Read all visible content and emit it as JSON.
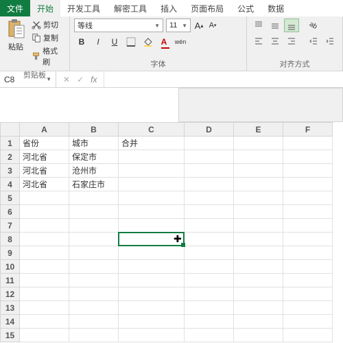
{
  "tabs": {
    "file": "文件",
    "home": "开始",
    "dev": "开发工具",
    "decrypt": "解密工具",
    "insert": "插入",
    "layout": "页面布局",
    "formulas": "公式",
    "data": "数据"
  },
  "clipboard": {
    "cut": "剪切",
    "copy": "复制",
    "paint": "格式刷",
    "paste": "粘贴",
    "group": "剪贴板"
  },
  "font": {
    "name": "等线",
    "size": "11",
    "group": "字体",
    "bold": "B",
    "italic": "I",
    "underline": "U",
    "wen": "wén"
  },
  "align": {
    "group": "对齐方式"
  },
  "namebox": "C8",
  "cols": [
    "A",
    "B",
    "C",
    "D",
    "E",
    "F"
  ],
  "rows": [
    "1",
    "2",
    "3",
    "4",
    "5",
    "6",
    "7",
    "8",
    "9",
    "10",
    "11",
    "12",
    "13",
    "14",
    "15"
  ],
  "cells": {
    "A1": "省份",
    "B1": "城市",
    "C1": "合并",
    "A2": "河北省",
    "B2": "保定市",
    "A3": "河北省",
    "B3": "沧州市",
    "A4": "河北省",
    "B4": "石家庄市"
  }
}
